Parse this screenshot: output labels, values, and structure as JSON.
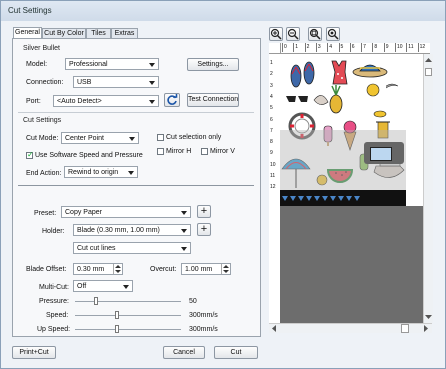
{
  "window": {
    "title": "Cut Settings"
  },
  "tabs": [
    "General",
    "Cut By Color",
    "Tiles",
    "Extras"
  ],
  "silver_bullet": {
    "group_label": "Silver Bullet",
    "model_label": "Model:",
    "model_value": "Professional",
    "settings_button": "Settings...",
    "connection_label": "Connection:",
    "connection_value": "USB",
    "port_label": "Port:",
    "port_value": "<Auto Detect>",
    "test_connection_button": "Test Connection"
  },
  "cut_settings": {
    "group_label": "Cut Settings",
    "cut_mode_label": "Cut Mode:",
    "cut_mode_value": "Center Point",
    "cut_selection_only": "Cut selection only",
    "use_software_speed": "Use Software Speed and Pressure",
    "mirror_h": "Mirror H",
    "mirror_v": "Mirror V",
    "end_action_label": "End Action:",
    "end_action_value": "Rewind to origin"
  },
  "preset": {
    "preset_label": "Preset:",
    "preset_value": "Copy Paper",
    "holder_label": "Holder:",
    "holder_value": "Blade (0.30 mm, 1.00 mm)",
    "cut_lines_value": "Cut cut lines",
    "blade_offset_label": "Blade Offset:",
    "blade_offset_value": "0.30 mm",
    "overcut_label": "Overcut:",
    "overcut_value": "1.00 mm",
    "multicut_label": "Multi-Cut:",
    "multicut_value": "Off",
    "pressure_label": "Pressure:",
    "pressure_value": "50",
    "pressure_fraction": 0.2,
    "speed_label": "Speed:",
    "speed_value": "300mm/s",
    "speed_fraction": 0.4,
    "upspeed_label": "Up Speed:",
    "upspeed_value": "300mm/s",
    "upspeed_fraction": 0.4
  },
  "buttons": {
    "print_cut": "Print+Cut",
    "cancel": "Cancel",
    "cut": "Cut"
  },
  "ruler_top": [
    "0",
    "1",
    "2",
    "3",
    "4",
    "5",
    "6",
    "7",
    "8",
    "9",
    "10",
    "11",
    "12"
  ],
  "ruler_left": [
    "1",
    "2",
    "3",
    "4",
    "5",
    "6",
    "7",
    "8",
    "9",
    "10",
    "11",
    "12"
  ],
  "colors": {
    "accent": "#1c56a8",
    "mat": "#ffffff",
    "canvas_bg": "#6d6d6d"
  }
}
